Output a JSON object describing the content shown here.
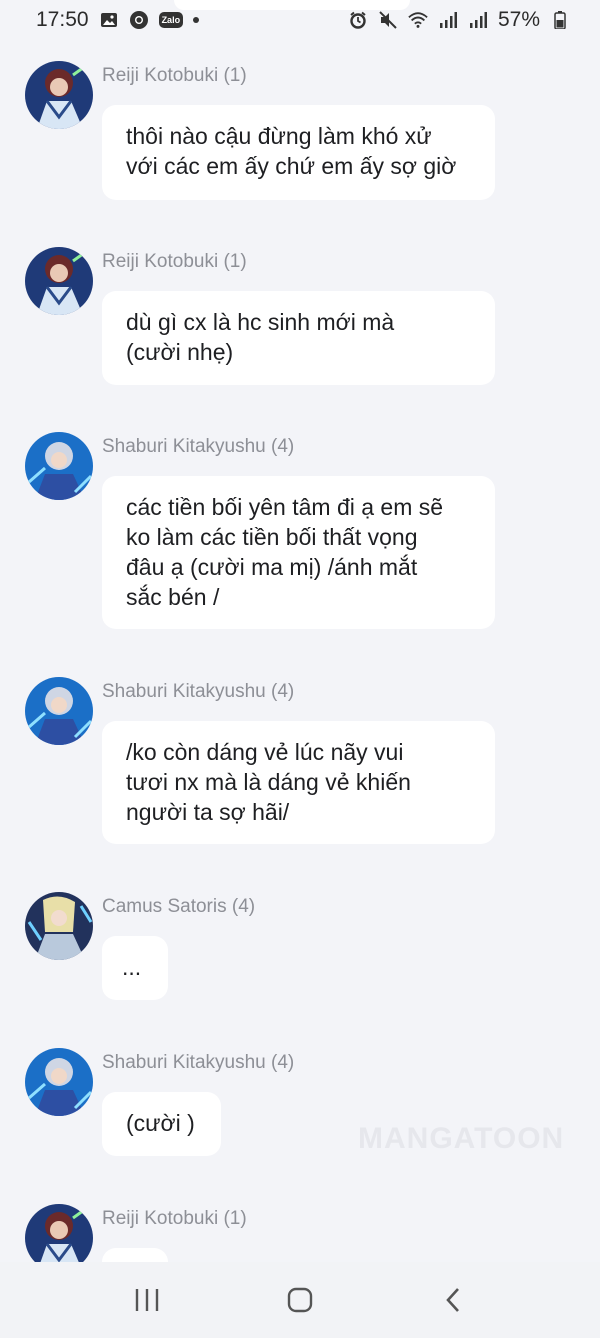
{
  "status_bar": {
    "time": "17:50",
    "left_icons": [
      "image-icon",
      "chrome-icon",
      "zalo-icon",
      "dot-icon"
    ],
    "zalo_text": "Zalo",
    "battery": "57%",
    "right_icons": [
      "alarm-icon",
      "mute-icon",
      "wifi-icon",
      "signal-icon",
      "signal-icon",
      "battery-icon"
    ]
  },
  "messages": [
    {
      "sender": "Reiji Kotobuki (1)",
      "avatar": "reiji",
      "text_lines": [
        "thôi nào cậu đừng làm khó xử",
        "với các em ấy chứ em ấy sợ giờ"
      ]
    },
    {
      "sender": "Reiji Kotobuki (1)",
      "avatar": "reiji",
      "text_lines": [
        "dù gì cx là hc sinh mới mà",
        "(cười nhẹ)"
      ]
    },
    {
      "sender": "Shaburi Kitakyushu (4)",
      "avatar": "shaburi",
      "text_lines": [
        "các tiền bối yên tâm đi ạ em sẽ",
        "ko làm các tiền bối thất vọng",
        "đâu ạ (cười ma mị) /ánh mắt",
        "sắc bén /"
      ]
    },
    {
      "sender": "Shaburi Kitakyushu (4)",
      "avatar": "shaburi",
      "text_lines": [
        "/ko còn dáng vẻ lúc nãy vui",
        "tươi nx mà là dáng vẻ khiến",
        "người ta sợ hãi/"
      ]
    },
    {
      "sender": "Camus Satoris (4)",
      "avatar": "camus",
      "text_lines": [
        "..."
      ]
    },
    {
      "sender": "Shaburi Kitakyushu (4)",
      "avatar": "shaburi",
      "text_lines": [
        "(cười )"
      ]
    },
    {
      "sender": "Reiji Kotobuki (1)",
      "avatar": "reiji",
      "text_lines": [
        ""
      ]
    }
  ],
  "watermark": "MANGATOON",
  "nav_bar": {
    "buttons": [
      "recent-apps-icon",
      "home-icon",
      "back-icon"
    ]
  },
  "colors": {
    "background": "#f3f4f8",
    "bubble": "#ffffff",
    "name": "#8d8f96"
  }
}
